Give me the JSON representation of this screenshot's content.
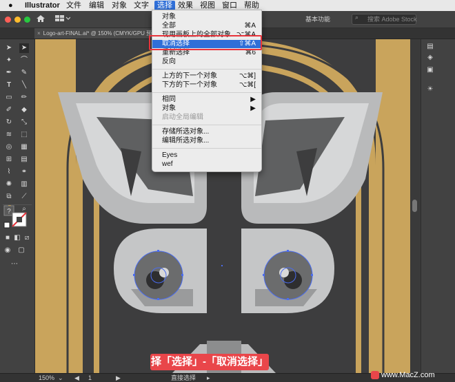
{
  "menubar": {
    "app_name": "Illustrator",
    "items": [
      "文件",
      "编辑",
      "对象",
      "文字",
      "选择",
      "效果",
      "视图",
      "窗口",
      "帮助"
    ],
    "active_item": "选择"
  },
  "appbar": {
    "workspace_label": "基本功能",
    "search_placeholder": "搜索 Adobe Stock"
  },
  "document_tab": {
    "title": "Logo-art-FINAL.ai* @ 150% (CMYK/GPU 预"
  },
  "select_menu": {
    "items": [
      {
        "label": "对象",
        "shortcut": ""
      },
      {
        "label": "全部",
        "shortcut": "⌘A"
      },
      {
        "label": "现用画板上的全部对象",
        "shortcut": "⌥⌘A"
      },
      {
        "label": "取消选择",
        "shortcut": "⇧⌘A",
        "highlighted": true
      },
      {
        "label": "重新选择",
        "shortcut": "⌘6"
      },
      {
        "label": "反向",
        "shortcut": ""
      },
      {
        "label": "上方的下一个对象",
        "shortcut": "⌥⌘]"
      },
      {
        "label": "下方的下一个对象",
        "shortcut": "⌥⌘["
      },
      {
        "label": "相同",
        "shortcut": "▶"
      },
      {
        "label": "对象",
        "shortcut": "▶"
      },
      {
        "label": "启动全局编辑",
        "shortcut": "",
        "disabled": true
      },
      {
        "label": "存储所选对象...",
        "shortcut": ""
      },
      {
        "label": "编辑所选对象...",
        "shortcut": ""
      },
      {
        "label": "Eyes",
        "shortcut": ""
      },
      {
        "label": "wef",
        "shortcut": ""
      }
    ]
  },
  "statusbar": {
    "zoom": "150%",
    "artboard": "1",
    "tool_name": "直接选择"
  },
  "caption": "择「选择」-「取消选择」",
  "watermark": "www.MacZ.com",
  "colors": {
    "gold": "#c9a45c",
    "dark": "#3d3d3e",
    "light_gray": "#cfd0d1",
    "mid_gray": "#9a9b9c",
    "selection": "#4a6cf0",
    "menu_highlight": "#2f6fd8",
    "callout_red": "#e8333b"
  }
}
